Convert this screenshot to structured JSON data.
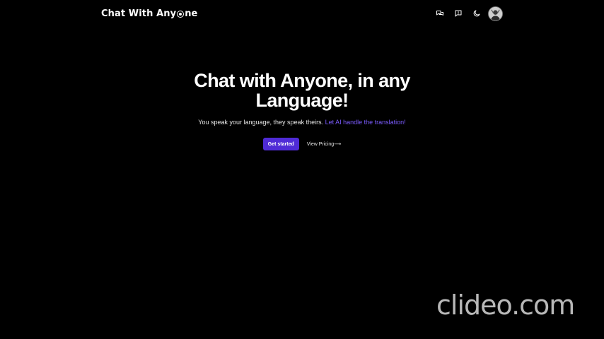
{
  "header": {
    "brand_prefix": "Chat With Any",
    "brand_suffix": "ne",
    "icons": [
      "chat-icon",
      "message-square-icon",
      "moon-icon"
    ],
    "avatar": "avatar"
  },
  "hero": {
    "title": "Chat with Anyone, in any Language!",
    "subtitle_plain": "You speak your language, they speak theirs.",
    "subtitle_accent": "Let AI handle the translation!",
    "primary_cta": "Get started",
    "secondary_cta": "View Pricing⟶"
  },
  "colors": {
    "background": "#000000",
    "accent": "#7c5cff",
    "primary_button": "#4f2bd6"
  },
  "watermark": "clideo.com"
}
